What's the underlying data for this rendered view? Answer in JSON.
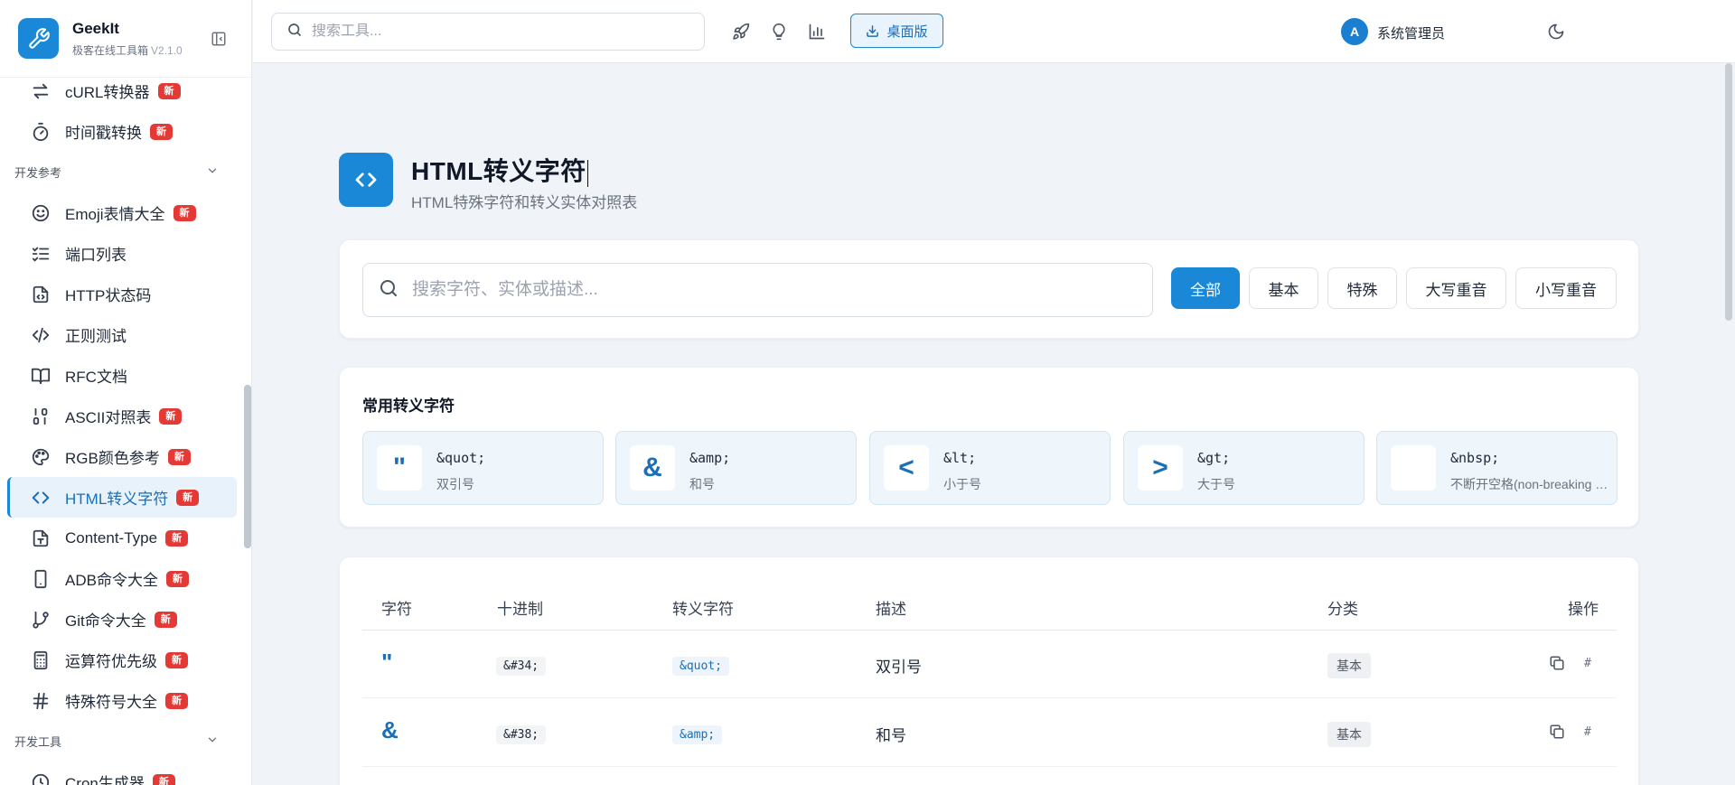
{
  "brand": {
    "name": "GeekIt",
    "subtitle": "极客在线工具箱",
    "version": "V2.1.0"
  },
  "sidebar": {
    "items_top": [
      {
        "label": "cURL转换器",
        "icon": "arrows-swap-icon",
        "badge": "新"
      },
      {
        "label": "时间戳转换",
        "icon": "stopwatch-icon",
        "badge": "新"
      }
    ],
    "section_dev_ref": "开发参考",
    "items_dev_ref": [
      {
        "label": "Emoji表情大全",
        "icon": "smile-icon",
        "badge": "新"
      },
      {
        "label": "端口列表",
        "icon": "list-check-icon",
        "badge": ""
      },
      {
        "label": "HTTP状态码",
        "icon": "file-code-icon",
        "badge": ""
      },
      {
        "label": "正则测试",
        "icon": "code-slash-icon",
        "badge": ""
      },
      {
        "label": "RFC文档",
        "icon": "book-open-icon",
        "badge": ""
      },
      {
        "label": "ASCII对照表",
        "icon": "binary-icon",
        "badge": "新"
      },
      {
        "label": "RGB颜色参考",
        "icon": "palette-icon",
        "badge": "新"
      },
      {
        "label": "HTML转义字符",
        "icon": "code-brackets-icon",
        "badge": "新",
        "active": true
      },
      {
        "label": "Content-Type",
        "icon": "file-type-icon",
        "badge": "新"
      },
      {
        "label": "ADB命令大全",
        "icon": "smartphone-icon",
        "badge": "新"
      },
      {
        "label": "Git命令大全",
        "icon": "git-branch-icon",
        "badge": "新"
      },
      {
        "label": "运算符优先级",
        "icon": "calculator-icon",
        "badge": "新"
      },
      {
        "label": "特殊符号大全",
        "icon": "hash-icon",
        "badge": "新"
      }
    ],
    "section_dev_tools": "开发工具",
    "items_dev_tools": [
      {
        "label": "Cron生成器",
        "icon": "clock-icon",
        "badge": "新"
      }
    ]
  },
  "topbar": {
    "search_placeholder": "搜索工具...",
    "desktop_label": "桌面版",
    "avatar_letter": "A",
    "user_name": "系统管理员"
  },
  "page": {
    "title": "HTML转义字符",
    "subtitle": "HTML特殊字符和转义实体对照表"
  },
  "filter": {
    "search_placeholder": "搜索字符、实体或描述...",
    "buttons": [
      "全部",
      "基本",
      "特殊",
      "大写重音",
      "小写重音"
    ],
    "active": "全部"
  },
  "common": {
    "title": "常用转义字符",
    "entities": [
      {
        "char": "\"",
        "entity": "&quot;",
        "desc": "双引号"
      },
      {
        "char": "&",
        "entity": "&amp;",
        "desc": "和号"
      },
      {
        "char": "<",
        "entity": "&lt;",
        "desc": "小于号"
      },
      {
        "char": ">",
        "entity": "&gt;",
        "desc": "大于号"
      },
      {
        "char": " ",
        "entity": "&nbsp;",
        "desc": "不断开空格(non-breaking space)"
      }
    ]
  },
  "table": {
    "headers": [
      "字符",
      "十进制",
      "转义字符",
      "描述",
      "分类",
      "操作"
    ],
    "rows": [
      {
        "char": "\"",
        "decimal": "&#34;",
        "entity": "&quot;",
        "desc": "双引号",
        "category": "基本",
        "action_hash": "#"
      },
      {
        "char": "&",
        "decimal": "&#38;",
        "entity": "&amp;",
        "desc": "和号",
        "category": "基本",
        "action_hash": "#"
      }
    ]
  },
  "colors": {
    "primary": "#1a88d6",
    "badge": "#e53935",
    "background": "#f0f4f8"
  }
}
